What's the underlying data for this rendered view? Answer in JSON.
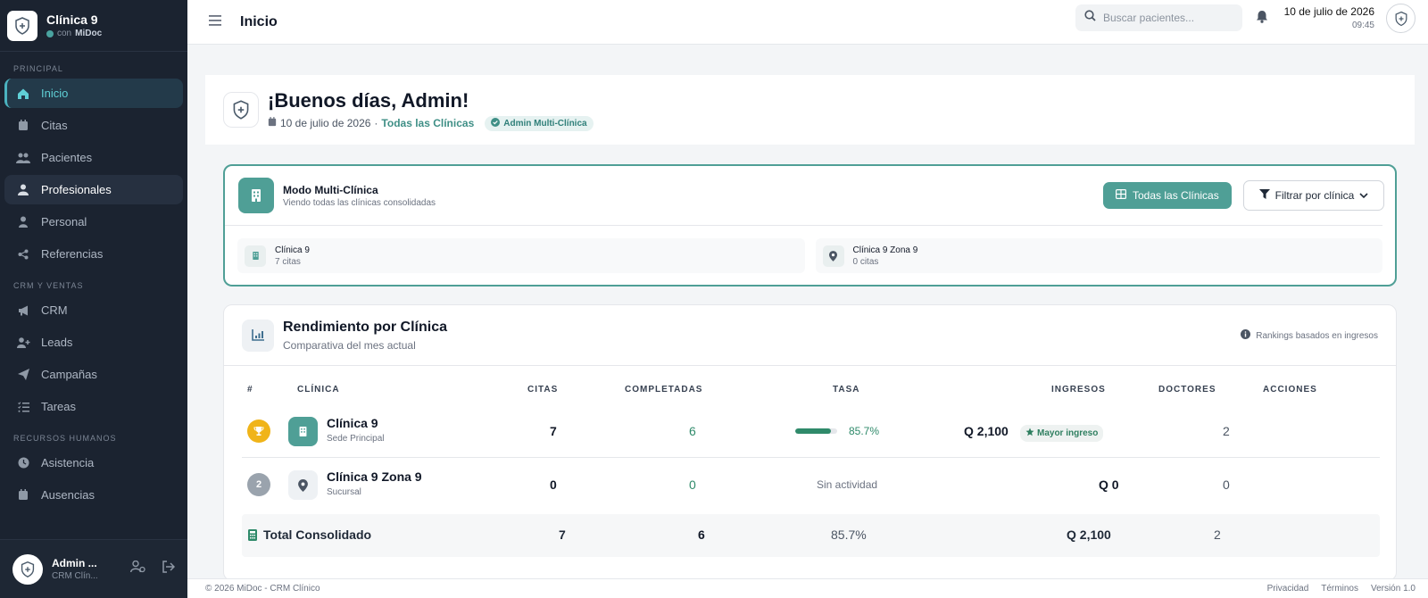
{
  "brand": {
    "name": "Clínica 9",
    "with": "con",
    "provider": "MiDoc"
  },
  "sidebar": {
    "sections": [
      "PRINCIPAL",
      "CRM Y VENTAS",
      "RECURSOS HUMANOS"
    ],
    "items": [
      {
        "label": "Inicio",
        "icon": "home-icon"
      },
      {
        "label": "Citas",
        "icon": "calendar-icon"
      },
      {
        "label": "Pacientes",
        "icon": "users-icon"
      },
      {
        "label": "Profesionales",
        "icon": "doctor-icon"
      },
      {
        "label": "Personal",
        "icon": "staff-icon"
      },
      {
        "label": "Referencias",
        "icon": "share-icon"
      },
      {
        "label": "CRM",
        "icon": "megaphone-icon"
      },
      {
        "label": "Leads",
        "icon": "user-plus-icon"
      },
      {
        "label": "Campañas",
        "icon": "paper-plane-icon"
      },
      {
        "label": "Tareas",
        "icon": "list-check-icon"
      },
      {
        "label": "Asistencia",
        "icon": "clock-icon"
      },
      {
        "label": "Ausencias",
        "icon": "calendar-x-icon"
      }
    ]
  },
  "user": {
    "name": "Admin ...",
    "role": "CRM Clín..."
  },
  "topbar": {
    "title": "Inicio",
    "search_placeholder": "Buscar pacientes...",
    "date": "10 de julio de 2026",
    "time": "09:45"
  },
  "greeting": {
    "title": "¡Buenos días, Admin!",
    "date": "10 de julio de 2026",
    "separator": "·",
    "scope": "Todas las Clínicas",
    "role_badge": "Admin Multi-Clínica"
  },
  "multi_clinic": {
    "title": "Modo Multi-Clínica",
    "description": "Viendo todas las clínicas consolidadas",
    "btn_all": "Todas las Clínicas",
    "btn_filter": "Filtrar por clínica",
    "clinics": [
      {
        "name": "Clínica 9",
        "count": "7 citas"
      },
      {
        "name": "Clínica 9 Zona 9",
        "count": "0 citas"
      }
    ]
  },
  "performance": {
    "title": "Rendimiento por Clínica",
    "description": "Comparativa del mes actual",
    "note": "Rankings basados en ingresos",
    "columns": [
      "#",
      "CLÍNICA",
      "CITAS",
      "COMPLETADAS",
      "TASA",
      "INGRESOS",
      "DOCTORES",
      "ACCIONES"
    ],
    "rows": [
      {
        "rank": "1",
        "name": "Clínica 9",
        "type": "Sede Principal",
        "citas": "7",
        "completadas": "6",
        "tasa": "85.7%",
        "tasa_fraction": 0.857,
        "ingresos": "Q 2,100",
        "badge": "Mayor ingreso",
        "doctores": "2"
      },
      {
        "rank": "2",
        "name": "Clínica 9 Zona 9",
        "type": "Sucursal",
        "citas": "0",
        "completadas": "0",
        "tasa": "Sin actividad",
        "ingresos": "Q 0",
        "doctores": "0"
      }
    ],
    "total": {
      "label": "Total Consolidado",
      "citas": "7",
      "completadas": "6",
      "tasa": "85.7%",
      "ingresos": "Q 2,100",
      "doctores": "2"
    }
  },
  "footer": {
    "copyright": "© 2026 MiDoc - CRM Clínico",
    "privacy": "Privacidad",
    "terms": "Términos",
    "version": "Versión 1.0"
  },
  "colors": {
    "accent": "#4f9f96",
    "sidebar_bg": "#1b2330",
    "gold": "#f0b419",
    "silver": "#9aa3ad"
  }
}
